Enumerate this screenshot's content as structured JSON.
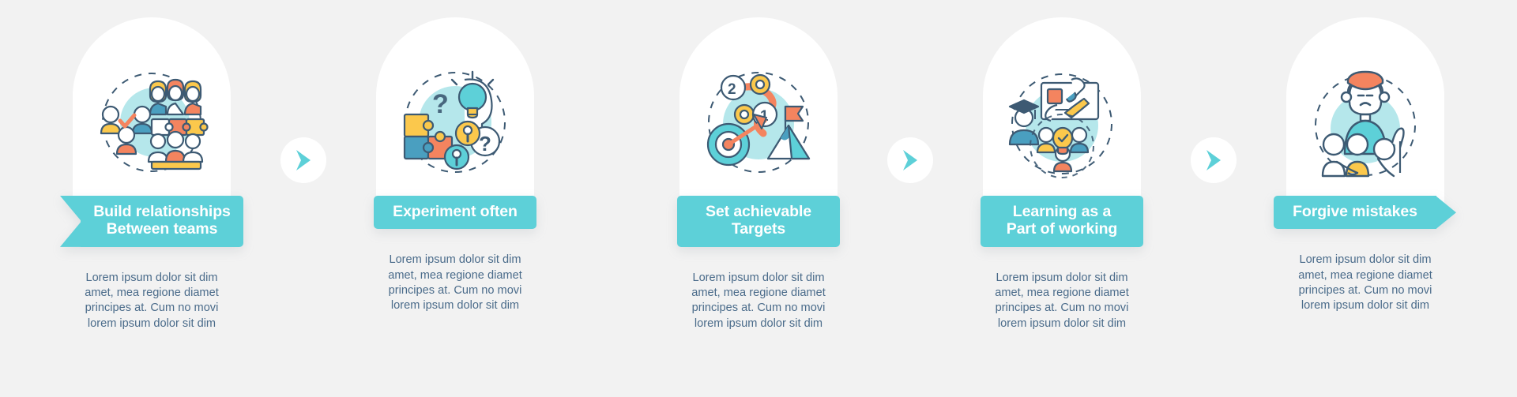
{
  "theme": {
    "background": "#f2f2f2",
    "card_background": "#ffffff",
    "accent_teal": "#5dd0d8",
    "accent_light_teal": "#a8e3e8",
    "accent_orange": "#f4845f",
    "accent_yellow": "#fbc84c",
    "accent_blue": "#4a9fc0",
    "outline": "#3d5a73",
    "body_text_color": "#4a6b8a",
    "banner_text_color": "#ffffff"
  },
  "body_copy": "Lorem ipsum dolor sit dim amet, mea regione diamet principes at. Cum no movi lorem ipsum dolor sit dim",
  "steps": [
    {
      "id": "build-relationships",
      "label": "Build relationships Between teams",
      "label_line1": "Build relationships",
      "label_line2": "Between teams",
      "banner_shape": "notch-left",
      "icon_name": "team-collaboration-icon",
      "body": "Lorem ipsum dolor sit dim amet, mea regione diamet principes at. Cum no movi lorem ipsum dolor sit dim"
    },
    {
      "id": "experiment-often",
      "label": "Experiment often",
      "label_line1": "Experiment often",
      "label_line2": "",
      "banner_shape": "plain",
      "icon_name": "puzzle-lightbulb-icon",
      "body": "Lorem ipsum dolor sit dim amet, mea regione diamet principes at. Cum no movi lorem ipsum dolor sit dim"
    },
    {
      "id": "set-achievable-targets",
      "label": "Set achievable Targets",
      "label_line1": "Set achievable",
      "label_line2": "Targets",
      "banner_shape": "plain",
      "icon_name": "target-mountain-flag-icon",
      "body": "Lorem ipsum dolor sit dim amet, mea regione diamet principes at. Cum no movi lorem ipsum dolor sit dim"
    },
    {
      "id": "learning-as-part-of-working",
      "label": "Learning as a Part of working",
      "label_line1": "Learning as a",
      "label_line2": "Part of working",
      "banner_shape": "plain",
      "icon_name": "graduate-learning-icon",
      "body": "Lorem ipsum dolor sit dim amet, mea regione diamet principes at. Cum no movi lorem ipsum dolor sit dim"
    },
    {
      "id": "forgive-mistakes",
      "label": "Forgive mistakes",
      "label_line1": "Forgive mistakes",
      "label_line2": "",
      "banner_shape": "tip-right",
      "icon_name": "sad-person-support-icon",
      "body": "Lorem ipsum dolor sit dim amet, mea regione diamet principes at. Cum no movi lorem ipsum dolor sit dim"
    }
  ],
  "connectors": [
    {
      "id": "connector-1-2",
      "icon_name": "chevron-right-icon"
    },
    {
      "id": "connector-3-4",
      "icon_name": "chevron-right-icon"
    },
    {
      "id": "connector-4-5",
      "icon_name": "chevron-right-icon"
    }
  ]
}
